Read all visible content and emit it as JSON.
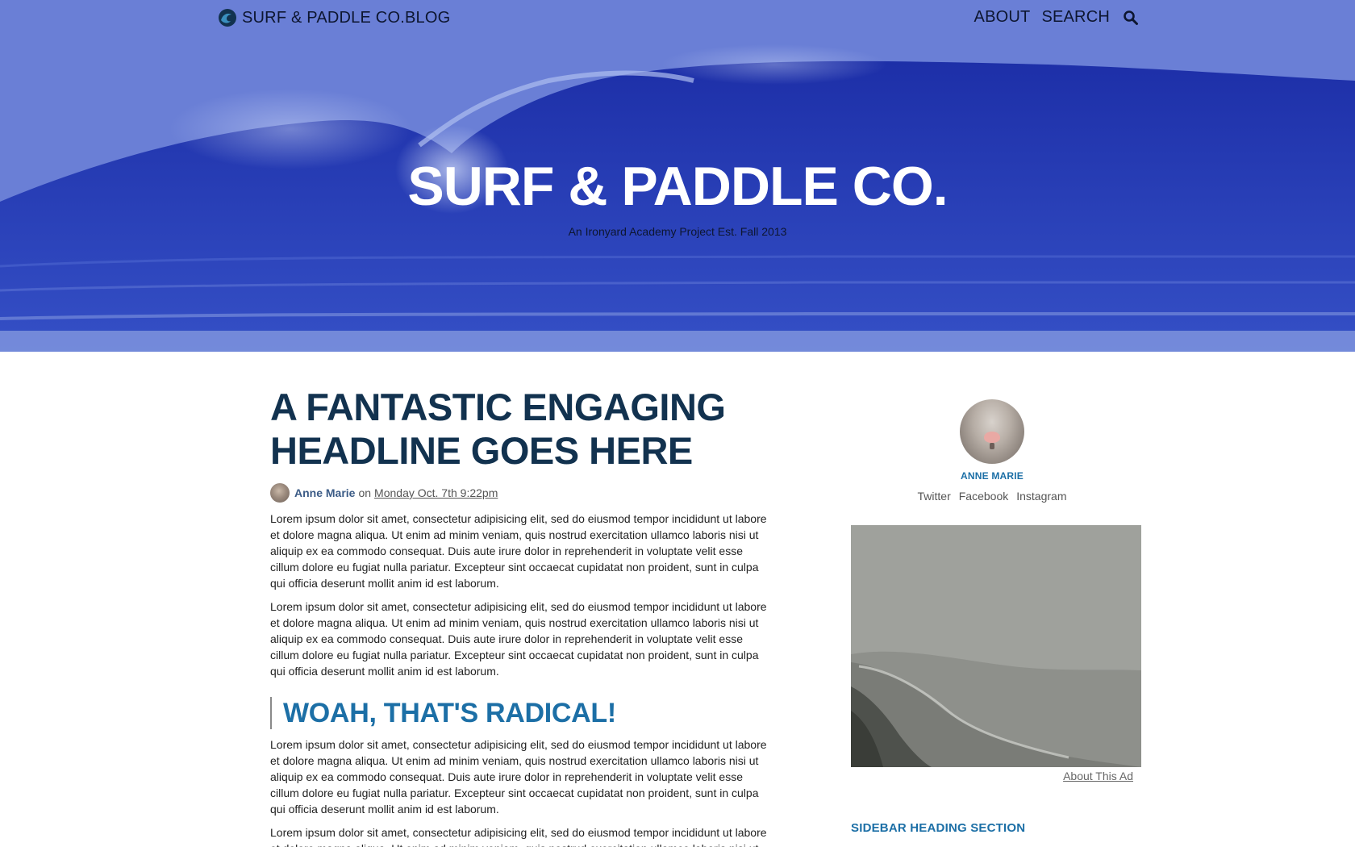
{
  "nav": {
    "brand": "SURF & PADDLE CO.BLOG",
    "links": [
      "ABOUT",
      "SEARCH"
    ]
  },
  "hero": {
    "title": "SURF & PADDLE CO.",
    "subtitle": "An Ironyard Academy Project Est. Fall 2013"
  },
  "article": {
    "headline": "A FANTASTIC ENGAGING HEADLINE GOES HERE",
    "author": "Anne Marie",
    "on": "on",
    "date": "Monday Oct. 7th 9:22pm",
    "paragraphs": [
      "Lorem ipsum dolor sit amet, consectetur adipisicing elit, sed do eiusmod tempor incididunt ut labore et dolore magna aliqua. Ut enim ad minim veniam, quis nostrud exercitation ullamco laboris nisi ut aliquip ex ea commodo consequat. Duis aute irure dolor in reprehenderit in voluptate velit esse cillum dolore eu fugiat nulla pariatur. Excepteur sint occaecat cupidatat non proident, sunt in culpa qui officia deserunt mollit anim id est laborum.",
      "Lorem ipsum dolor sit amet, consectetur adipisicing elit, sed do eiusmod tempor incididunt ut labore et dolore magna aliqua. Ut enim ad minim veniam, quis nostrud exercitation ullamco laboris nisi ut aliquip ex ea commodo consequat. Duis aute irure dolor in reprehenderit in voluptate velit esse cillum dolore eu fugiat nulla pariatur. Excepteur sint occaecat cupidatat non proident, sunt in culpa qui officia deserunt mollit anim id est laborum.",
      "Lorem ipsum dolor sit amet, consectetur adipisicing elit, sed do eiusmod tempor incididunt ut labore et dolore magna aliqua. Ut enim ad minim veniam, quis nostrud exercitation ullamco laboris nisi ut aliquip ex ea commodo consequat. Duis aute irure dolor in reprehenderit in voluptate velit esse cillum dolore eu fugiat nulla pariatur. Excepteur sint occaecat cupidatat non proident, sunt in culpa qui officia deserunt mollit anim id est laborum.",
      "Lorem ipsum dolor sit amet, consectetur adipisicing elit, sed do eiusmod tempor incididunt ut labore et dolore magna aliqua. Ut enim ad minim veniam, quis nostrud exercitation ullamco laboris nisi ut aliquip ex ea commodo consequat."
    ],
    "pullquote": "WOAH, THAT'S RADICAL!"
  },
  "sidebar": {
    "profile_name": "ANNE MARIE",
    "social": [
      "Twitter",
      "Facebook",
      "Instagram"
    ],
    "ad_caption": "About This Ad",
    "heading": "SIDEBAR HEADING SECTION"
  },
  "colors": {
    "headline": "#12324f",
    "accent": "#1c6fa6",
    "hero_blue": "#2b40b9"
  },
  "icons": [
    "logo-wave-icon",
    "search-icon"
  ]
}
